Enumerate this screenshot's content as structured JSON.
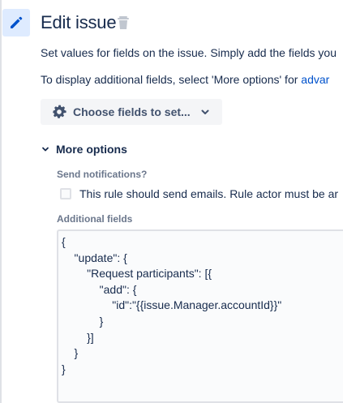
{
  "header": {
    "title": "Edit issue",
    "edit_icon": "pencil-icon",
    "delete_icon": "trash-icon"
  },
  "description": {
    "line1": "Set values for fields on the issue. Simply add the fields you",
    "line2_prefix": "To display additional fields, select 'More options' for ",
    "line2_link": "advar"
  },
  "choose_fields": {
    "label": "Choose fields to set...",
    "icon": "gear-icon"
  },
  "more_options": {
    "label": "More options",
    "expanded": true
  },
  "send_notifications": {
    "label": "Send notifications?",
    "checkbox_label": "This rule should send emails. Rule actor must be ar",
    "checked": false
  },
  "additional_fields": {
    "label": "Additional fields",
    "value": "{\n    \"update\": {\n        \"Request participants\": [{\n            \"add\": {\n                \"id\":\"{{issue.Manager.accountId}}\"\n            }\n        }]\n    }\n}"
  },
  "colors": {
    "accent": "#0052cc",
    "icon_bg": "#deebff",
    "text": "#172b4d",
    "muted": "#6b778c"
  }
}
